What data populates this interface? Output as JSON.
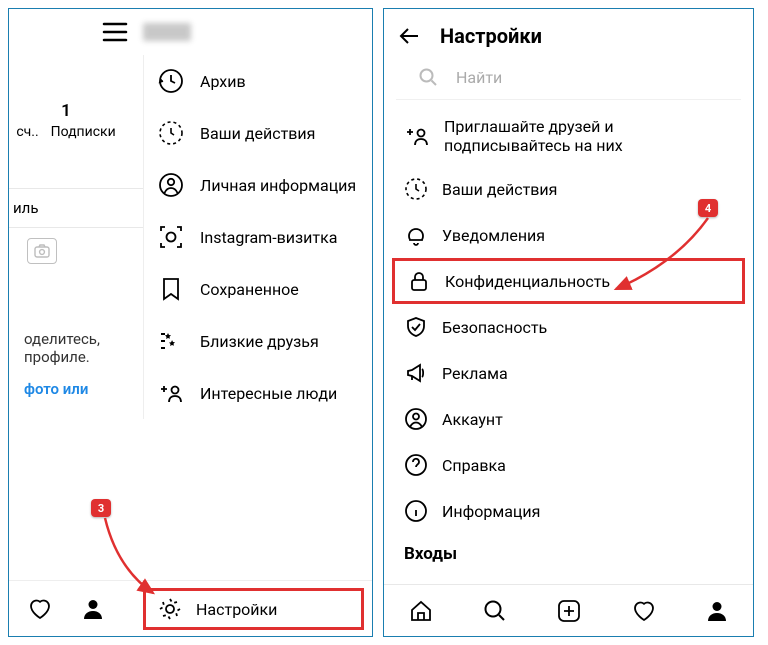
{
  "left": {
    "stat_number": "1",
    "stat_label_1": "сч..",
    "stat_label_2": "Подписки",
    "profile_tab_label": "иль",
    "share_line1": "оделитесь,",
    "share_line2": "профиле.",
    "share_link": "фото или",
    "menu": {
      "archive": "Архив",
      "activity": "Ваши действия",
      "personal_info": "Личная информация",
      "nametag": "Instagram-визитка",
      "saved": "Сохраненное",
      "close_friends": "Близкие друзья",
      "discover": "Интересные люди"
    },
    "settings_label": "Настройки",
    "step_badge": "3"
  },
  "right": {
    "title": "Настройки",
    "search_placeholder": "Найти",
    "invite_line1": "Приглашайте друзей и",
    "invite_line2": "подписывайтесь на них",
    "items": {
      "activity": "Ваши действия",
      "notifications": "Уведомления",
      "privacy": "Конфиденциальность",
      "security": "Безопасность",
      "ads": "Реклама",
      "account": "Аккаунт",
      "help": "Справка",
      "about": "Информация"
    },
    "section_logins": "Входы",
    "step_badge": "4"
  }
}
